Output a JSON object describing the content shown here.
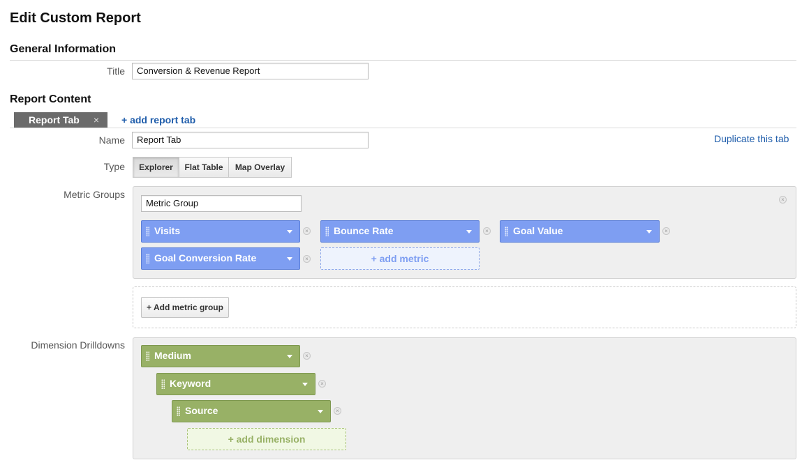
{
  "page_title": "Edit Custom Report",
  "general": {
    "heading": "General Information",
    "title_label": "Title",
    "title_value": "Conversion & Revenue Report"
  },
  "content": {
    "heading": "Report Content",
    "tabs": [
      {
        "label": "Report Tab",
        "close": "×"
      }
    ],
    "add_tab_label": "+ add report tab",
    "duplicate_label": "Duplicate this tab",
    "name_label": "Name",
    "name_value": "Report Tab",
    "type_label": "Type",
    "types": [
      "Explorer",
      "Flat Table",
      "Map Overlay"
    ],
    "selected_type": "Explorer",
    "metric_groups_label": "Metric Groups",
    "metric_group_name": "Metric Group",
    "metrics": [
      "Visits",
      "Bounce Rate",
      "Goal Value",
      "Goal Conversion Rate"
    ],
    "add_metric_label": "+ add metric",
    "add_metric_group_label": "+ Add metric group",
    "dimension_label": "Dimension Drilldowns",
    "dimensions": [
      "Medium",
      "Keyword",
      "Source"
    ],
    "add_dimension_label": "+ add dimension"
  },
  "colors": {
    "metric_pill": "#7e9ef2",
    "dimension_pill": "#98b166",
    "link": "#1f5dab",
    "active_tab": "#6b6b6b"
  }
}
